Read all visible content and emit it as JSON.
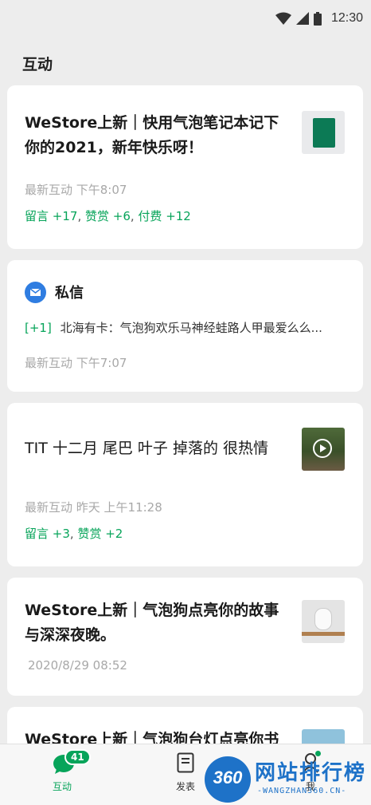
{
  "status_bar": {
    "time": "12:30",
    "icons": [
      "wifi-icon",
      "signal-icon",
      "battery-icon"
    ]
  },
  "page": {
    "title": "互动"
  },
  "cards": [
    {
      "title_line1": "WeStore上新｜快用气泡笔记本记下",
      "title_line2": "你的2021，新年快乐呀！",
      "meta": "最新互动  下午8:07",
      "stats": [
        {
          "label": "留言 +17"
        },
        {
          "label": "赞赏 +6"
        },
        {
          "label": "付费 +12"
        }
      ]
    },
    {
      "header": "私信",
      "badge": "[+1]",
      "preview": "北海有卡：气泡狗欢乐马神经蛙路人甲最爱么么...",
      "meta": "最新互动  下午7:07"
    },
    {
      "title_line1": "TIT 十二月 尾巴 叶子 掉落的 很热情",
      "meta": "最新互动 昨天 上午11:28",
      "stats": [
        {
          "label": "留言 +3"
        },
        {
          "label": "赞赏 +2"
        }
      ]
    },
    {
      "title_line1": "WeStore上新｜气泡狗点亮你的故事",
      "title_line2": "与深深夜晚。",
      "meta": "2020/8/29  08:52"
    },
    {
      "title_line1": "WeStore上新｜气泡狗台灯点亮你书"
    }
  ],
  "tabbar": {
    "tabs": [
      {
        "label": "互动",
        "badge": "41"
      },
      {
        "label": "发表"
      },
      {
        "label": "我"
      }
    ]
  },
  "watermark": {
    "brand": "网站排行榜",
    "number": "360",
    "sub": "-WANGZHAN360.CN-"
  },
  "colors": {
    "accent": "#07a45a",
    "badge": "#f0544d",
    "link_blue": "#1e72c8"
  }
}
